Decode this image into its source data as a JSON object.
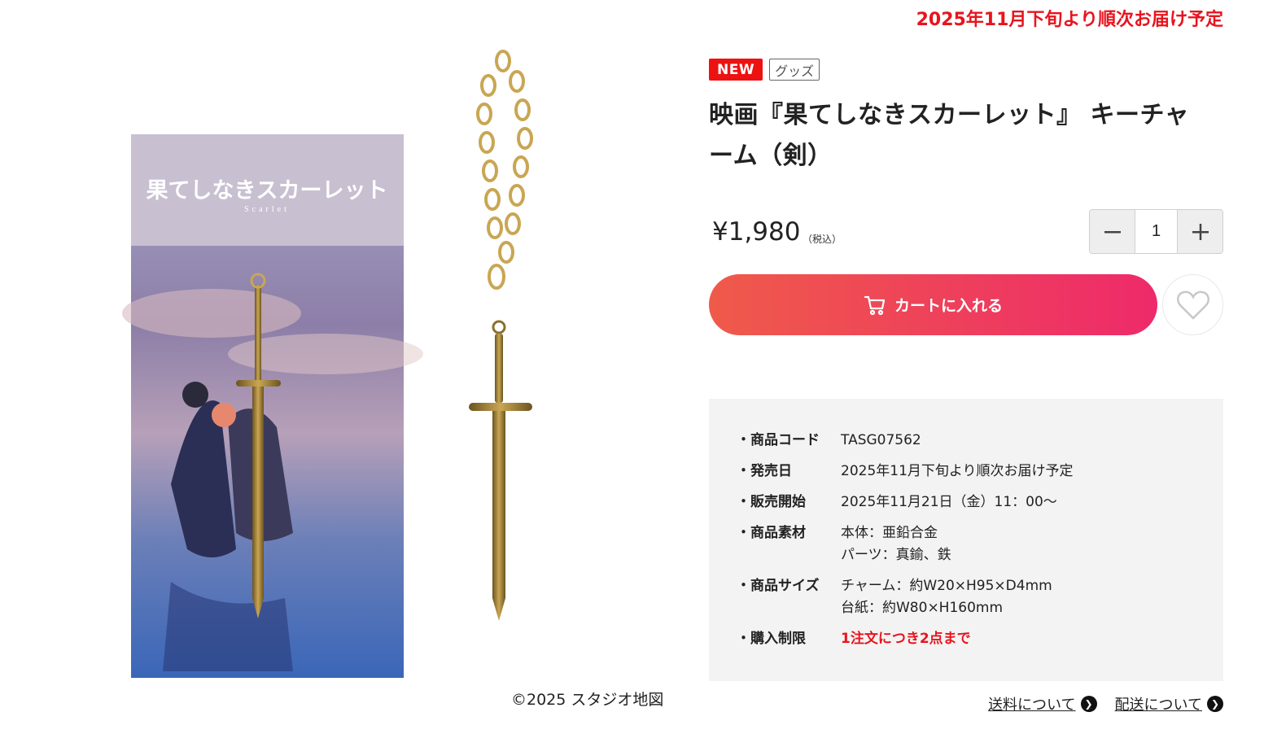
{
  "delivery_notice": "2025年11月下旬より順次お届け予定",
  "image": {
    "package_title": "果てしなきスカーレット",
    "package_subtitle": "Scarlet",
    "copyright": "©2025 スタジオ地図"
  },
  "product": {
    "badge_new": "NEW",
    "badge_category": "グッズ",
    "title": "映画『果てしなきスカーレット』 キーチャーム（剣）",
    "price": "¥1,980",
    "tax_note": "（税込）"
  },
  "quantity": {
    "value": "1",
    "minus_icon": "minus-icon",
    "plus_icon": "plus-icon"
  },
  "cart_button": {
    "label": "カートに入れる",
    "icon": "cart-icon"
  },
  "favorite_icon": "heart-icon",
  "specs": [
    {
      "label": "商品コード",
      "value": "TASG07562"
    },
    {
      "label": "発売日",
      "value": "2025年11月下旬より順次お届け予定"
    },
    {
      "label": "販売開始",
      "value": "2025年11月21日（金）11：00〜"
    },
    {
      "label": "商品素材",
      "value": "本体：亜鉛合金",
      "value2": "パーツ：真鍮、鉄"
    },
    {
      "label": "商品サイズ",
      "value": "チャーム：約W20×H95×D4mm",
      "value2": "台紙：約W80×H160mm"
    },
    {
      "label": "購入制限",
      "value": "1注文につき2点まで"
    }
  ],
  "links": {
    "shipping_fee": "送料について",
    "delivery": "配送について"
  },
  "colors": {
    "accent_red": "#e8141e",
    "cart_gradient_start": "#ef5a4a",
    "cart_gradient_end": "#ee2a6a"
  }
}
